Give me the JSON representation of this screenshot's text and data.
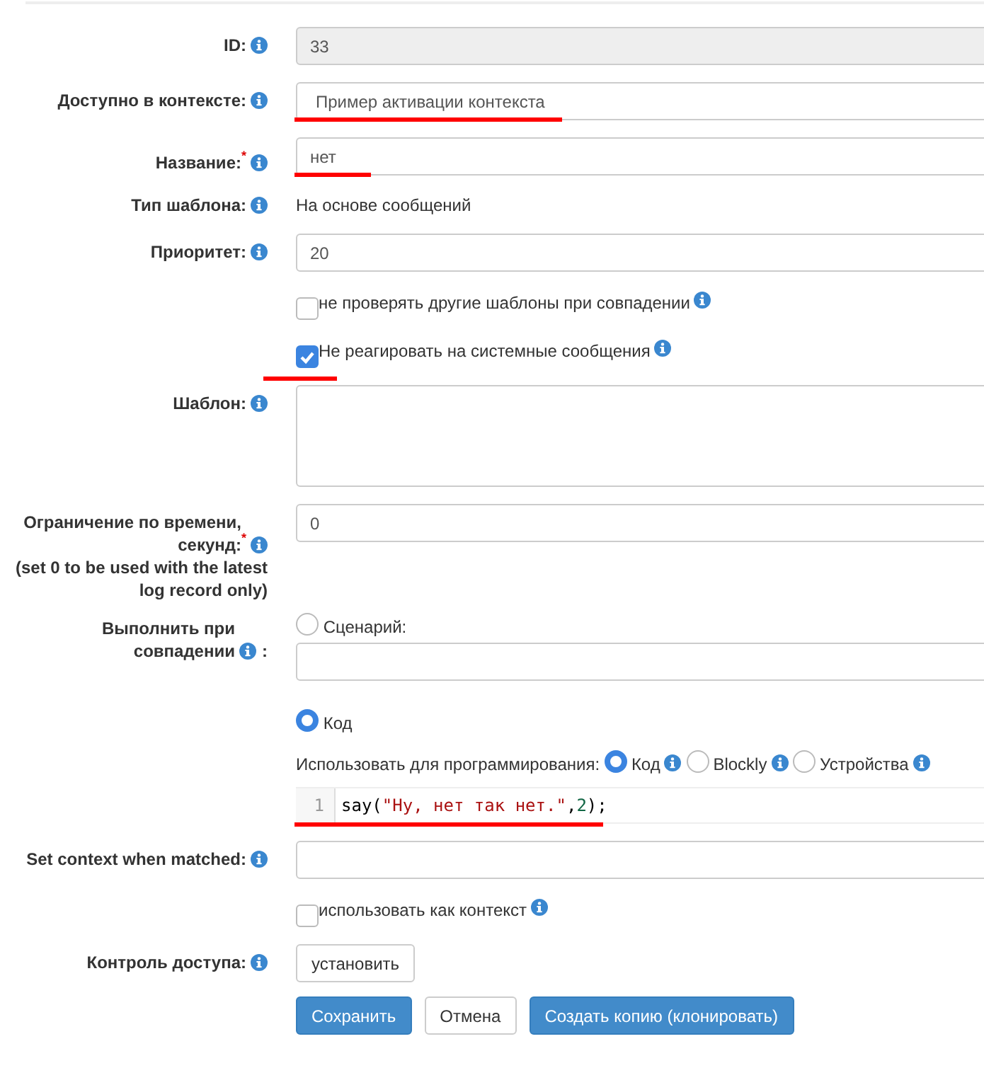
{
  "rows": [
    {
      "kind": "input",
      "label": "ID:",
      "info": true,
      "value": "33",
      "disabled": true
    },
    {
      "kind": "input",
      "label": "Доступно в контексте:",
      "info": true,
      "value": "Пример активации контекста",
      "underlined": true
    },
    {
      "kind": "input",
      "label": "Название:",
      "required_mark": "*",
      "info": true,
      "value": "нет",
      "underlined": true
    },
    {
      "kind": "text",
      "label": "Тип шаблона:",
      "info": true,
      "value": "На основе сообщений"
    },
    {
      "kind": "input",
      "label": "Приоритет:",
      "info": true,
      "value": "20"
    },
    {
      "kind": "checkbox",
      "text": "не проверять другие шаблоны при совпадении",
      "info": true,
      "checked": false
    },
    {
      "kind": "checkbox",
      "text": "Не реагировать на системные сообщения",
      "info": true,
      "checked": true,
      "underlined": true
    },
    {
      "kind": "textarea",
      "label": "Шаблон:",
      "info": true
    },
    {
      "kind": "input",
      "label": "Ограничение по времени, секунд:",
      "required_mark": "*",
      "info": true,
      "note": "(set 0 to be used with the latest log record only)",
      "value": "0"
    },
    {
      "kind": "execute",
      "label": "Выполнить при совпадении",
      "info": true,
      "suffix": ":",
      "script_option": {
        "label": "Сценарий:",
        "selected": false
      },
      "code_option": {
        "label": "Код",
        "selected": true
      },
      "programming": {
        "label": "Использовать для программирования:",
        "options": [
          {
            "label": "Код",
            "selected": true,
            "info": true
          },
          {
            "label": "Blockly",
            "selected": false,
            "info": true
          },
          {
            "label": "Устройства",
            "selected": false,
            "info": true
          }
        ]
      },
      "code": {
        "line_number": "1",
        "underlined": true,
        "tokens": [
          {
            "color": "#000000",
            "text": "say("
          },
          {
            "color": "#aa1111",
            "text": "\"Ну, нет так нет.\""
          },
          {
            "color": "#000000",
            "text": ","
          },
          {
            "color": "#116644",
            "text": "2"
          },
          {
            "color": "#000000",
            "text": ");"
          }
        ]
      }
    },
    {
      "kind": "input",
      "label": "Set context when matched:",
      "info": true
    },
    {
      "kind": "checkbox",
      "text": "использовать как контекст",
      "info": true,
      "checked": false
    },
    {
      "kind": "button",
      "label": "Контроль доступа:",
      "info": true,
      "button": "установить"
    }
  ],
  "buttons": [
    {
      "label": "Сохранить",
      "kind": "primary"
    },
    {
      "label": "Отмена",
      "kind": "default"
    },
    {
      "label": "Создать копию (клонировать)",
      "kind": "primary"
    }
  ]
}
